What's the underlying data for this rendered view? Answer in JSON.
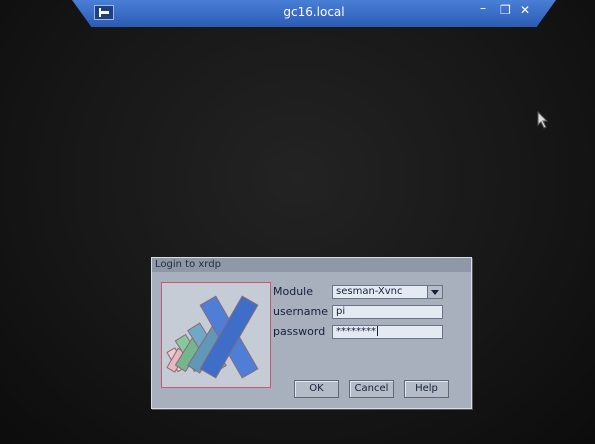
{
  "remote_window": {
    "title": "gc16.local",
    "minimize_glyph": "–",
    "restore_glyph": "❐",
    "close_glyph": "✕"
  },
  "login_dialog": {
    "title": "Login to xrdp",
    "logo": "xrdp-logo",
    "fields": {
      "module_label": "Module",
      "module_value": "sesman-Xvnc",
      "username_label": "username",
      "username_value": "pi",
      "password_label": "password",
      "password_value": "********"
    },
    "buttons": {
      "ok": "OK",
      "cancel": "Cancel",
      "help": "Help"
    }
  },
  "colors": {
    "titlebar_blue": "#3a6dc6",
    "dialog_gray": "#a7b0bc",
    "desktop_black": "#121212"
  }
}
